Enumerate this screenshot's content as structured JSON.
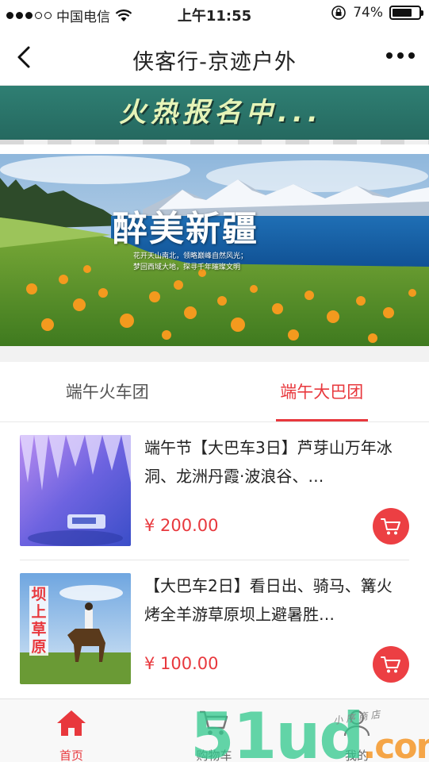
{
  "status_bar": {
    "carrier": "中国电信",
    "time": "上午11:55",
    "battery": "74%",
    "battery_level": 0.74
  },
  "nav": {
    "title": "侠客行-京迹户外",
    "back_icon": "chevron-left-icon",
    "more_icon": "more-dots-icon"
  },
  "banner_strip": {
    "text": "火热报名中..."
  },
  "hero": {
    "title": "醉美新疆",
    "subtitle_line1": "花开天山南北，领略巅峰自然风光；",
    "subtitle_line2": "梦回西域大地，探寻千年璀璨文明"
  },
  "tabs": [
    {
      "label": "端午火车团",
      "active": false
    },
    {
      "label": "端午大巴团",
      "active": true
    }
  ],
  "products": [
    {
      "name": "端午节【大巴车3日】芦芽山万年冰洞、龙洲丹霞·波浪谷、…",
      "price": "¥ 200.00"
    },
    {
      "name": "【大巴车2日】看日出、骑马、篝火烤全羊游草原坝上避暑胜…",
      "price": "¥ 100.00",
      "thumb_text": "坝上草原"
    }
  ],
  "tabbar": [
    {
      "label": "首页",
      "icon": "home-icon",
      "active": true
    },
    {
      "label": "购物车",
      "icon": "cart-icon",
      "active": false
    },
    {
      "label": "我的",
      "icon": "user-icon",
      "active": false
    }
  ],
  "watermark": {
    "main": "51ud",
    "suffix": ".com",
    "small": "小 序 商 店"
  },
  "colors": {
    "accent": "#e8383d",
    "strip": "#2f7f73"
  }
}
